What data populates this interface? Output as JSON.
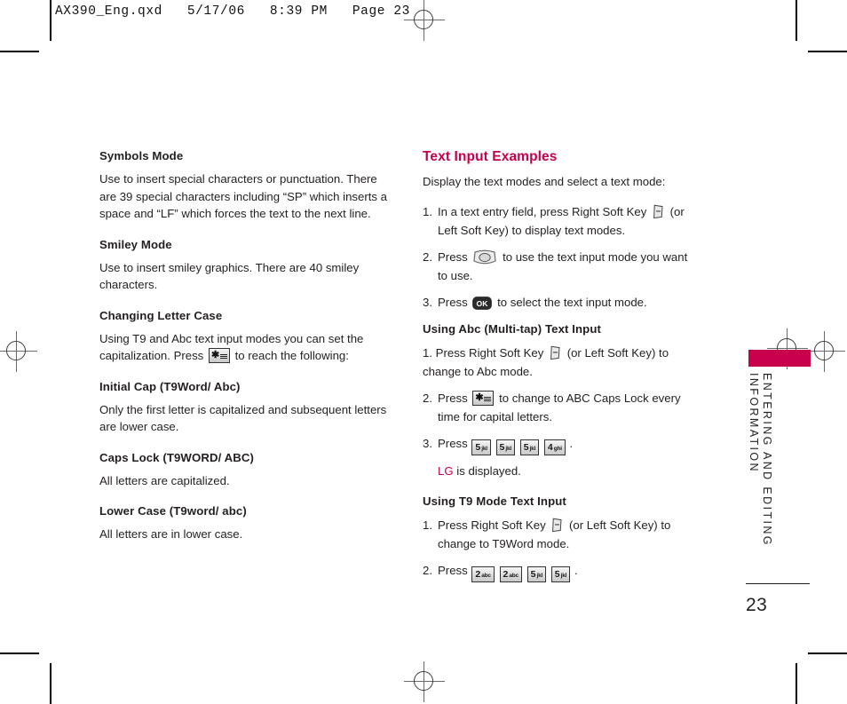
{
  "prepress": {
    "header": "AX390_Eng.qxd   5/17/06   8:39 PM   Page 23"
  },
  "left_column": {
    "blocks": [
      {
        "heading": "Symbols Mode",
        "body": "Use to insert special characters or punctuation. There are 39 special characters including “SP” which inserts a space and “LF” which forces the text to the next line."
      },
      {
        "heading": "Smiley Mode",
        "body": "Use to insert smiley graphics. There are 40 smiley characters."
      },
      {
        "heading": "Changing Letter Case",
        "body_before_key": "Using T9 and Abc text input modes you can set the capitalization. Press",
        "body_after_key": "to reach the following:",
        "key_label": "star-key"
      },
      {
        "heading": "Initial Cap (T9Word/ Abc)",
        "body": "Only the first letter is capitalized and subsequent letters are lower case."
      },
      {
        "heading": "Caps Lock (T9WORD/ ABC)",
        "body": "All letters are capitalized."
      },
      {
        "heading": "Lower Case (T9word/ abc)",
        "body": "All letters are in lower case."
      }
    ]
  },
  "right_column": {
    "title": "Text Input Examples",
    "intro": "Display the text modes and select a text mode:",
    "steps_main": [
      {
        "num": "1.",
        "part1": "In a text entry field, press Right Soft Key",
        "part2": "(or",
        "line2": "Left  Soft Key) to display text modes."
      },
      {
        "num": "2.",
        "part1": "Press",
        "part2": "to use the text input mode you want",
        "line2": "to use."
      },
      {
        "num": "3.",
        "part1": "Press",
        "part2": "to select the text input mode."
      }
    ],
    "abc_section": {
      "heading": "Using Abc (Multi-tap) Text Input",
      "step1": {
        "num": "1.",
        "part1": "Press Right Soft Key",
        "part2": "(or Left Soft Key) to",
        "line2": "change to Abc mode."
      },
      "step2": {
        "num": "2.",
        "part1": "Press",
        "part2": "to change to ABC Caps Lock every",
        "line2": "time for capital letters."
      },
      "step3": {
        "num": "3.",
        "part1": "Press",
        "keys": [
          {
            "digit": "5",
            "letters": "jkl"
          },
          {
            "digit": "5",
            "letters": "jkl"
          },
          {
            "digit": "5",
            "letters": "jkl"
          },
          {
            "digit": "4",
            "letters": "ghi"
          }
        ],
        "trailing": "."
      },
      "result_accent": "LG",
      "result_rest": "is displayed."
    },
    "t9_section": {
      "heading": "Using T9 Mode Text Input",
      "step1": {
        "num": "1.",
        "part1": "Press Right Soft Key",
        "part2": "(or Left Soft Key) to",
        "line2": "change to T9Word mode."
      },
      "step2": {
        "num": "2.",
        "part1": "Press",
        "keys": [
          {
            "digit": "2",
            "letters": "abc"
          },
          {
            "digit": "2",
            "letters": "abc"
          },
          {
            "digit": "5",
            "letters": "jkl"
          },
          {
            "digit": "5",
            "letters": "jkl"
          }
        ],
        "trailing": "."
      }
    }
  },
  "side_tab": {
    "line1": "ENTERING  AND  EDITING",
    "line2": "INFORMATION",
    "color": "#c8004b"
  },
  "folio": {
    "page_number": "23"
  },
  "colors": {
    "accent": "#c8004b",
    "text": "#231f20"
  }
}
